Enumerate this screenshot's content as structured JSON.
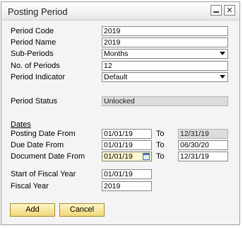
{
  "window": {
    "title": "Posting Period"
  },
  "form": {
    "period_code": {
      "label": "Period Code",
      "value": "2019"
    },
    "period_name": {
      "label": "Period Name",
      "value": "2019"
    },
    "sub_periods": {
      "label": "Sub-Periods",
      "value": "Months"
    },
    "no_of_periods": {
      "label": "No. of Periods",
      "value": "12"
    },
    "period_indicator": {
      "label": "Period Indicator",
      "value": "Default"
    },
    "period_status": {
      "label": "Period Status",
      "value": "Unlocked"
    }
  },
  "dates": {
    "heading": "Dates",
    "to_label": "To",
    "posting": {
      "label": "Posting Date From",
      "from": "01/01/19",
      "to": "12/31/19"
    },
    "due": {
      "label": "Due Date From",
      "from": "01/01/19",
      "to": "06/30/20"
    },
    "document": {
      "label": "Document Date From",
      "from": "01/01/19",
      "to": "12/31/19"
    }
  },
  "fiscal": {
    "start": {
      "label": "Start of Fiscal Year",
      "value": "01/01/19"
    },
    "year": {
      "label": "Fiscal Year",
      "value": "2019"
    }
  },
  "buttons": {
    "add": "Add",
    "cancel": "Cancel"
  }
}
